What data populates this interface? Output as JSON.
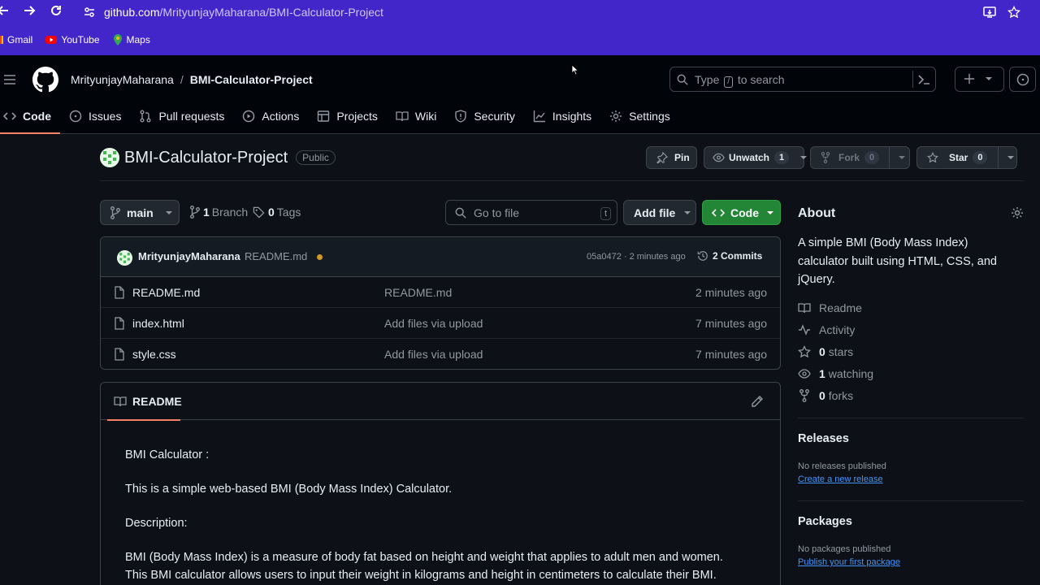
{
  "browser": {
    "url_host": "github.com",
    "url_path": "/MrityunjayMaharana/BMI-Calculator-Project",
    "bookmarks": [
      {
        "label": "Gmail",
        "icon": "gmail-icon"
      },
      {
        "label": "YouTube",
        "icon": "youtube-icon"
      },
      {
        "label": "Maps",
        "icon": "maps-icon"
      }
    ]
  },
  "header": {
    "owner": "MrityunjayMaharana",
    "separator": "/",
    "repo": "BMI-Calculator-Project",
    "search_placeholder_before": "Type",
    "search_key": "/",
    "search_placeholder_after": "to search"
  },
  "nav": {
    "tabs": [
      {
        "label": "Code",
        "icon": "code-icon",
        "active": true
      },
      {
        "label": "Issues",
        "icon": "issue-icon"
      },
      {
        "label": "Pull requests",
        "icon": "pull-request-icon"
      },
      {
        "label": "Actions",
        "icon": "play-icon"
      },
      {
        "label": "Projects",
        "icon": "table-icon"
      },
      {
        "label": "Wiki",
        "icon": "book-icon"
      },
      {
        "label": "Security",
        "icon": "shield-icon"
      },
      {
        "label": "Insights",
        "icon": "graph-icon"
      },
      {
        "label": "Settings",
        "icon": "gear-icon"
      }
    ]
  },
  "repo": {
    "name": "BMI-Calculator-Project",
    "visibility": "Public",
    "pin_label": "Pin",
    "watch_label": "Unwatch",
    "watch_count": "1",
    "fork_label": "Fork",
    "fork_count": "0",
    "star_label": "Star",
    "star_count": "0"
  },
  "toolbar": {
    "branch": "main",
    "branch_count": "1",
    "branch_label": "Branch",
    "tag_count": "0",
    "tag_label": "Tags",
    "goto_placeholder": "Go to file",
    "goto_key": "t",
    "add_file_label": "Add file",
    "code_label": "Code"
  },
  "commit": {
    "author": "MrityunjayMaharana",
    "message": "README.md",
    "hash_time": "05a0472 · 2 minutes ago",
    "commits_label": "2 Commits"
  },
  "files": [
    {
      "name": "README.md",
      "message": "README.md",
      "date": "2 minutes ago"
    },
    {
      "name": "index.html",
      "message": "Add files via upload",
      "date": "7 minutes ago"
    },
    {
      "name": "style.css",
      "message": "Add files via upload",
      "date": "7 minutes ago"
    }
  ],
  "readme": {
    "tab_label": "README",
    "p1": "BMI Calculator :",
    "p2": "This is a simple web-based BMI (Body Mass Index) Calculator.",
    "p3": "Description:",
    "p4a": "BMI (Body Mass Index) is a measure of body fat based on height and weight that applies to adult men and women.",
    "p4b": "This BMI calculator allows users to input their weight in kilograms and height in centimeters to calculate their BMI."
  },
  "about": {
    "heading": "About",
    "description": "A simple BMI (Body Mass Index) calculator built using HTML, CSS, and jQuery.",
    "readme_link": "Readme",
    "activity_link": "Activity",
    "stars_count": "0",
    "stars_label": "stars",
    "watching_count": "1",
    "watching_label": "watching",
    "forks_count": "0",
    "forks_label": "forks"
  },
  "releases": {
    "heading": "Releases",
    "note": "No releases published",
    "link": "Create a new release"
  },
  "packages": {
    "heading": "Packages",
    "note": "No packages published",
    "link": "Publish your first package"
  },
  "colors": {
    "browser_bar": "#4226c9",
    "page_bg": "#0d1117",
    "header_bg": "#010409",
    "accent_green": "#238636",
    "tab_underline": "#f78166",
    "link_blue": "#4493f8"
  }
}
